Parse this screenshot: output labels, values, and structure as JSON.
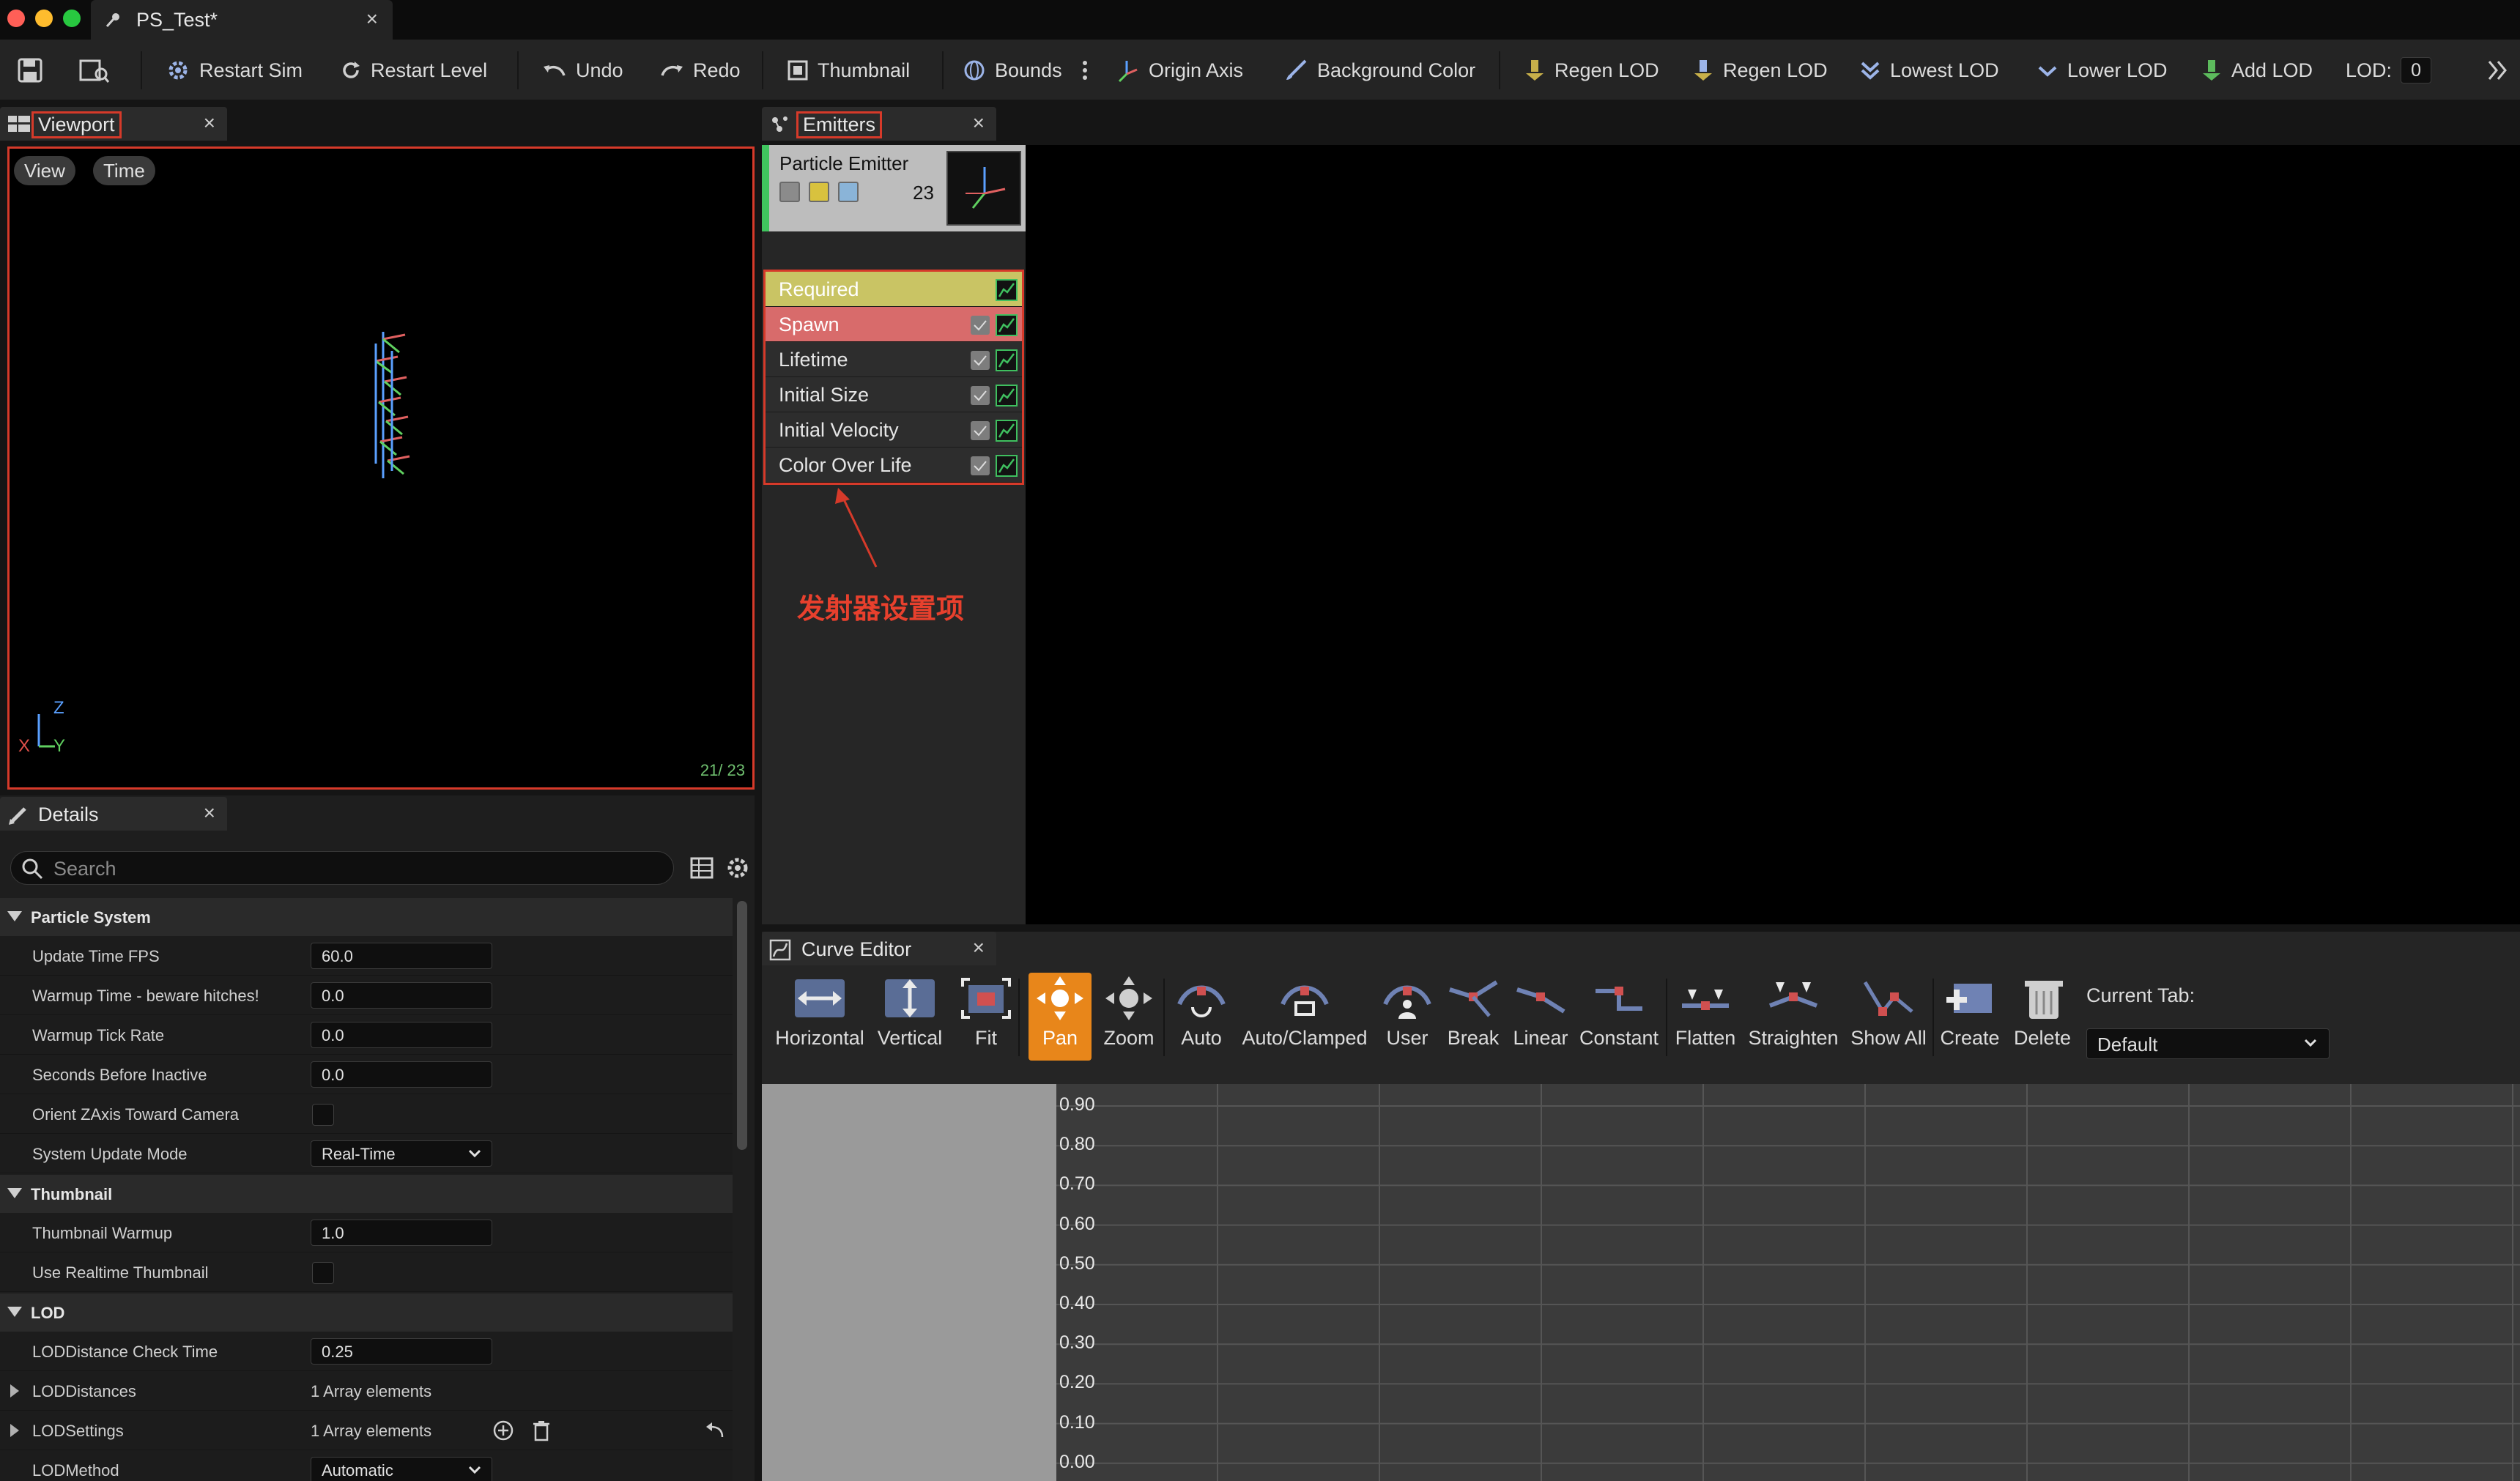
{
  "window": {
    "tab_title": "PS_Test*",
    "close_glyph": "×"
  },
  "toolbar": {
    "restart_sim": "Restart Sim",
    "restart_level": "Restart Level",
    "undo": "Undo",
    "redo": "Redo",
    "thumbnail": "Thumbnail",
    "bounds": "Bounds",
    "origin_axis": "Origin Axis",
    "background_color": "Background Color",
    "regen_lod_1": "Regen LOD",
    "regen_lod_2": "Regen LOD",
    "lowest_lod": "Lowest LOD",
    "lower_lod": "Lower LOD",
    "add_lod": "Add LOD",
    "lod_label": "LOD:",
    "lod_value": "0"
  },
  "viewport": {
    "tab_label": "Viewport",
    "view_button": "View",
    "time_button": "Time",
    "axis_z": "Z",
    "axis_x": "X",
    "axis_y": "Y",
    "particle_counter": "21/ 23"
  },
  "emitters": {
    "tab_label": "Emitters",
    "emitter_name": "Particle Emitter",
    "particle_count": "23",
    "modules": [
      {
        "label": "Required",
        "color": "#c9c464",
        "has_check": false
      },
      {
        "label": "Spawn",
        "color": "#d86b6b",
        "has_check": true
      },
      {
        "label": "Lifetime",
        "color": "#2d2d2d",
        "has_check": true
      },
      {
        "label": "Initial Size",
        "color": "#2d2d2d",
        "has_check": true
      },
      {
        "label": "Initial Velocity",
        "color": "#2d2d2d",
        "has_check": true
      },
      {
        "label": "Color Over Life",
        "color": "#2d2d2d",
        "has_check": true
      }
    ],
    "annotation": "发射器设置项"
  },
  "details": {
    "tab_label": "Details",
    "search_placeholder": "Search",
    "sections": {
      "particle_system": "Particle System",
      "thumbnail": "Thumbnail",
      "lod": "LOD"
    },
    "props": {
      "update_time_fps": {
        "label": "Update Time FPS",
        "value": "60.0"
      },
      "warmup_time": {
        "label": "Warmup Time - beware hitches!",
        "value": "0.0"
      },
      "warmup_tick_rate": {
        "label": "Warmup Tick Rate",
        "value": "0.0"
      },
      "seconds_before_inactive": {
        "label": "Seconds Before Inactive",
        "value": "0.0"
      },
      "orient_zaxis": {
        "label": "Orient ZAxis Toward Camera"
      },
      "system_update_mode": {
        "label": "System Update Mode",
        "value": "Real-Time"
      },
      "thumbnail_warmup": {
        "label": "Thumbnail Warmup",
        "value": "1.0"
      },
      "use_realtime_thumbnail": {
        "label": "Use Realtime Thumbnail"
      },
      "loddistance_check_time": {
        "label": "LODDistance Check Time",
        "value": "0.25"
      },
      "loddistances": {
        "label": "LODDistances",
        "value": "1 Array elements"
      },
      "lodsettings": {
        "label": "LODSettings",
        "value": "1 Array elements"
      },
      "lodmethod": {
        "label": "LODMethod",
        "value": "Automatic"
      }
    }
  },
  "curve_editor": {
    "tab_label": "Curve Editor",
    "tools": {
      "horizontal": "Horizontal",
      "vertical": "Vertical",
      "fit": "Fit",
      "pan": "Pan",
      "zoom": "Zoom",
      "auto": "Auto",
      "auto_clamped": "Auto/Clamped",
      "user": "User",
      "break": "Break",
      "linear": "Linear",
      "constant": "Constant",
      "flatten": "Flatten",
      "straighten": "Straighten",
      "show_all": "Show All",
      "create": "Create",
      "delete": "Delete"
    },
    "current_tab_label": "Current Tab:",
    "current_tab_value": "Default",
    "y_axis": [
      "0.90",
      "0.80",
      "0.70",
      "0.60",
      "0.50",
      "0.40",
      "0.30",
      "0.20",
      "0.10",
      "0.00"
    ]
  },
  "colors": {
    "accent_orange": "#e8861a",
    "annotation_red": "#d63a2a",
    "emitter_green": "#3fc55e"
  }
}
